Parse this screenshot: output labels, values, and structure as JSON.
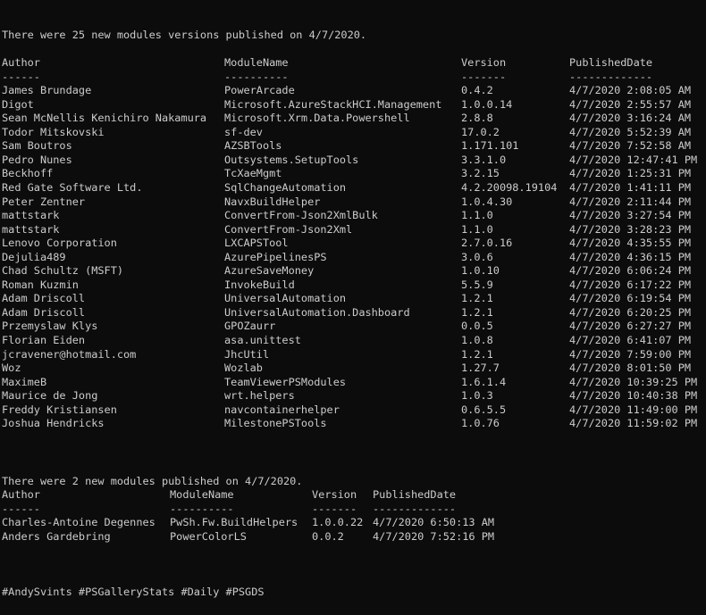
{
  "section1": {
    "summary": "There were 25 new modules versions published on 4/7/2020.",
    "headers": [
      "Author",
      "ModuleName",
      "Version",
      "PublishedDate"
    ],
    "underlines": [
      "------",
      "----------",
      "-------",
      "-------------"
    ],
    "rows": [
      [
        "James Brundage",
        "PowerArcade",
        "0.4.2",
        "4/7/2020 2:08:05 AM"
      ],
      [
        "Digot",
        "Microsoft.AzureStackHCI.Management",
        "1.0.0.14",
        "4/7/2020 2:55:57 AM"
      ],
      [
        "Sean McNellis Kenichiro Nakamura",
        "Microsoft.Xrm.Data.Powershell",
        "2.8.8",
        "4/7/2020 3:16:24 AM"
      ],
      [
        "Todor Mitskovski",
        "sf-dev",
        "17.0.2",
        "4/7/2020 5:52:39 AM"
      ],
      [
        "Sam Boutros",
        "AZSBTools",
        "1.171.101",
        "4/7/2020 7:52:58 AM"
      ],
      [
        "Pedro Nunes",
        "Outsystems.SetupTools",
        "3.3.1.0",
        "4/7/2020 12:47:41 PM"
      ],
      [
        "Beckhoff",
        "TcXaeMgmt",
        "3.2.15",
        "4/7/2020 1:25:31 PM"
      ],
      [
        "Red Gate Software Ltd.",
        "SqlChangeAutomation",
        "4.2.20098.19104",
        "4/7/2020 1:41:11 PM"
      ],
      [
        "Peter Zentner",
        "NavxBuildHelper",
        "1.0.4.30",
        "4/7/2020 2:11:44 PM"
      ],
      [
        "mattstark",
        "ConvertFrom-Json2XmlBulk",
        "1.1.0",
        "4/7/2020 3:27:54 PM"
      ],
      [
        "mattstark",
        "ConvertFrom-Json2Xml",
        "1.1.0",
        "4/7/2020 3:28:23 PM"
      ],
      [
        "Lenovo Corporation",
        "LXCAPSTool",
        "2.7.0.16",
        "4/7/2020 4:35:55 PM"
      ],
      [
        "Dejulia489",
        "AzurePipelinesPS",
        "3.0.6",
        "4/7/2020 4:36:15 PM"
      ],
      [
        "Chad Schultz (MSFT)",
        "AzureSaveMoney",
        "1.0.10",
        "4/7/2020 6:06:24 PM"
      ],
      [
        "Roman Kuzmin",
        "InvokeBuild",
        "5.5.9",
        "4/7/2020 6:17:22 PM"
      ],
      [
        "Adam Driscoll",
        "UniversalAutomation",
        "1.2.1",
        "4/7/2020 6:19:54 PM"
      ],
      [
        "Adam Driscoll",
        "UniversalAutomation.Dashboard",
        "1.2.1",
        "4/7/2020 6:20:25 PM"
      ],
      [
        "Przemyslaw Klys",
        "GPOZaurr",
        "0.0.5",
        "4/7/2020 6:27:27 PM"
      ],
      [
        "Florian Eiden",
        "asa.unittest",
        "1.0.8",
        "4/7/2020 6:41:07 PM"
      ],
      [
        "jcravener@hotmail.com",
        "JhcUtil",
        "1.2.1",
        "4/7/2020 7:59:00 PM"
      ],
      [
        "Woz",
        "Wozlab",
        "1.27.7",
        "4/7/2020 8:01:50 PM"
      ],
      [
        "MaximeB",
        "TeamViewerPSModules",
        "1.6.1.4",
        "4/7/2020 10:39:25 PM"
      ],
      [
        "Maurice de Jong",
        "wrt.helpers",
        "1.0.3",
        "4/7/2020 10:40:38 PM"
      ],
      [
        "Freddy Kristiansen",
        "navcontainerhelper",
        "0.6.5.5",
        "4/7/2020 11:49:00 PM"
      ],
      [
        "Joshua Hendricks",
        "MilestonePSTools",
        "1.0.76",
        "4/7/2020 11:59:02 PM"
      ]
    ]
  },
  "section2": {
    "summary": "There were 2 new modules published on 4/7/2020.",
    "headers": [
      "Author",
      "ModuleName",
      "Version",
      "PublishedDate"
    ],
    "underlines": [
      "------",
      "----------",
      "-------",
      "-------------"
    ],
    "rows": [
      [
        "Charles-Antoine Degennes",
        "PwSh.Fw.BuildHelpers",
        "1.0.0.22",
        "4/7/2020 6:50:13 AM"
      ],
      [
        "Anders Gardebring",
        "PowerColorLS",
        "0.0.2",
        "4/7/2020 7:52:16 PM"
      ]
    ]
  },
  "hashtags": "#AndySvints #PSGalleryStats #Daily #PSGDS",
  "colors": {
    "background": "#0c0c0c",
    "foreground": "#cccccc"
  }
}
